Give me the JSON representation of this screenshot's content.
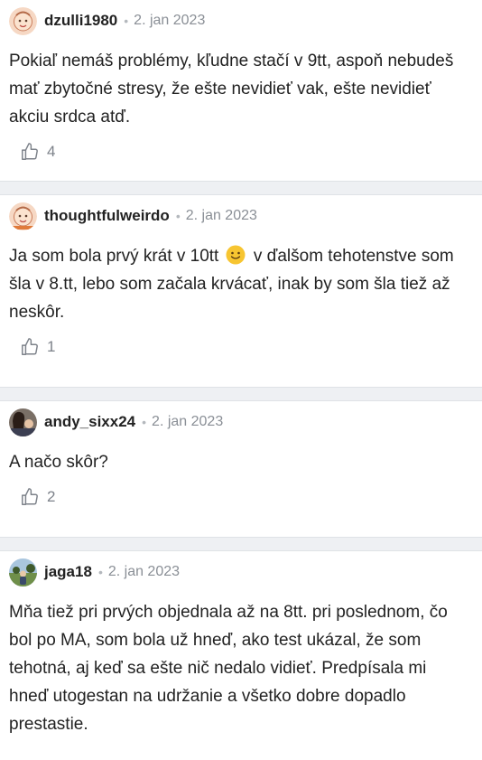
{
  "comments": [
    {
      "username": "dzulli1980",
      "separator": "•",
      "date": "2. jan 2023",
      "text": "Pokiaľ nemáš problémy, kľudne stačí v 9tt, aspoň nebudeš mať zbytočné stresy, že ešte nevidieť vak, ešte nevidieť akciu srdca atď.",
      "likes": "4",
      "avatar": "cartoon-baby-avatar"
    },
    {
      "username": "thoughtfulweirdo",
      "separator": "•",
      "date": "2. jan 2023",
      "text_before_emoji": "Ja som bola prvý krát v 10tt",
      "text_after_emoji": "v ďalšom tehotenstve som šla v 8.tt, lebo som začala krvácať, inak by som šla tiež až neskôr.",
      "emoji": "slightly-smiling-face",
      "likes": "1",
      "avatar": "cartoon-baby-avatar"
    },
    {
      "username": "andy_sixx24",
      "separator": "•",
      "date": "2. jan 2023",
      "text": "A načo skôr?",
      "likes": "2",
      "avatar": "photo-avatar"
    },
    {
      "username": "jaga18",
      "separator": "•",
      "date": "2. jan 2023",
      "text": "Mňa tiež pri prvých objednala až na 8tt. pri poslednom, čo bol po MA, som bola už hneď, ako test ukázal, že som tehotná, aj keď sa ešte nič nedalo vidieť. Predpísala mi hneď utogestan na udržanie a všetko dobre dopadlo prestastie.",
      "avatar": "photo-avatar"
    }
  ],
  "colors": {
    "divider": "#eef0f3",
    "meta": "#8a8f96",
    "text": "#222222"
  }
}
